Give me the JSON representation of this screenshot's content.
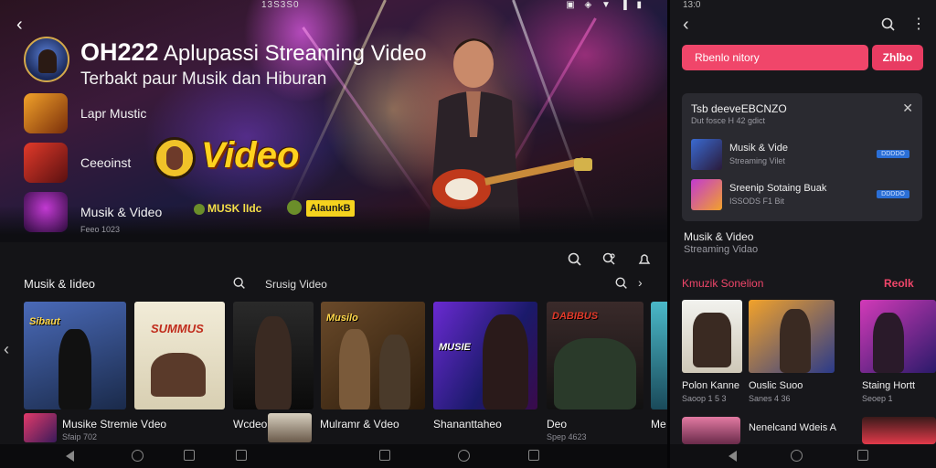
{
  "status": {
    "time": "13S3S0",
    "icons": "▣ ◈ ▼ ▐ ▮"
  },
  "app": {
    "title": "OH222",
    "title_rest": " Aplupassi Streaming Video",
    "tagline": "Terbakt paur Musik dan Hiburan"
  },
  "categories": [
    {
      "label": "Lapr Mustic",
      "sub": ""
    },
    {
      "label": "Ceeoinst",
      "sub": ""
    },
    {
      "label": "Musik & Video",
      "sub": "Feeo 1023"
    }
  ],
  "promo": {
    "video_text": "Video",
    "musk_text": "MUSK lIdc",
    "tag_text": "AlaunkB"
  },
  "section": {
    "title": "Musik & Iideo",
    "search_label": "Srusig Video"
  },
  "posters": [
    {
      "title": "Sibaut"
    },
    {
      "title": "SUMMUS"
    },
    {
      "title": ""
    },
    {
      "title": "Musilo"
    },
    {
      "title": "MUSIE"
    },
    {
      "title": "DABIBUS"
    },
    {
      "title": ""
    }
  ],
  "bottom_items": [
    {
      "label": "Musike Stremie Vdeo",
      "sub": "Sfaip 702"
    },
    {
      "label": "Wcdeo",
      "sub": ""
    },
    {
      "label": "Mulramr & Vdeo",
      "sub": ""
    },
    {
      "label": "Shananttaheo",
      "sub": ""
    },
    {
      "label": "Deo",
      "sub": "Spep 4623"
    },
    {
      "label": "Me",
      "sub": ""
    }
  ],
  "right": {
    "status": "13:0",
    "input_value": "Rbenlo nitory",
    "button_label": "Zhlbo",
    "card": {
      "title": "Tsb deeveEBCNZO",
      "sub": "Dut fosce H 42 gdict",
      "rows": [
        {
          "label": "Musik & Vide",
          "sub": "Streaming Vilet",
          "badge": "DDDDO"
        },
        {
          "label": "Sreenip Sotaing Buak",
          "sub": "ISSODS F1 Bit",
          "badge": "DDDDO"
        }
      ]
    },
    "list_title": "Musik & Video",
    "list_sub": "Streaming Vidao",
    "section_title": "Kmuzik Sonelion",
    "section_more": "Reolk",
    "posters": [
      {
        "label": "Polon Kanne",
        "sub": "Saoop 1 5 3"
      },
      {
        "label": "Ouslic Suoo",
        "sub": "Sanes 4 36"
      },
      {
        "label": "Staing Hortt",
        "sub": "Seoep 1"
      }
    ],
    "bottom_label": "Nenelcand Wdeis A",
    "bottom_sub": ""
  },
  "colors": {
    "accent": "#f0466a",
    "video_yellow": "#ffd21e",
    "badge_blue": "#2b6fd6"
  }
}
